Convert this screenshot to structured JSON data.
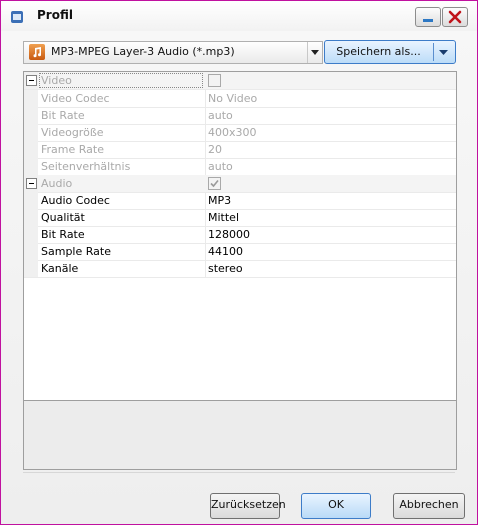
{
  "window": {
    "title": "Profil",
    "accent": "#c0119f"
  },
  "toolbar": {
    "format_value": "MP3-MPEG Layer-3 Audio (*.mp3)",
    "save_as_label": "Speichern als..."
  },
  "properties": {
    "video": {
      "category_label": "Video",
      "checked": false,
      "rows": [
        {
          "key": "Video Codec",
          "value": "No Video"
        },
        {
          "key": "Bit Rate",
          "value": "auto"
        },
        {
          "key": "Videogröße",
          "value": "400x300"
        },
        {
          "key": "Frame Rate",
          "value": "20"
        },
        {
          "key": "Seitenverhältnis",
          "value": "auto"
        }
      ]
    },
    "audio": {
      "category_label": "Audio",
      "checked": true,
      "rows": [
        {
          "key": "Audio Codec",
          "value": "MP3"
        },
        {
          "key": "Qualität",
          "value": "Mittel"
        },
        {
          "key": "Bit Rate",
          "value": "128000"
        },
        {
          "key": "Sample Rate",
          "value": "44100"
        },
        {
          "key": "Kanäle",
          "value": "stereo"
        }
      ]
    }
  },
  "buttons": {
    "reset_label": "Zurücksetzen",
    "ok_label": "OK",
    "cancel_label": "Abbrechen"
  }
}
